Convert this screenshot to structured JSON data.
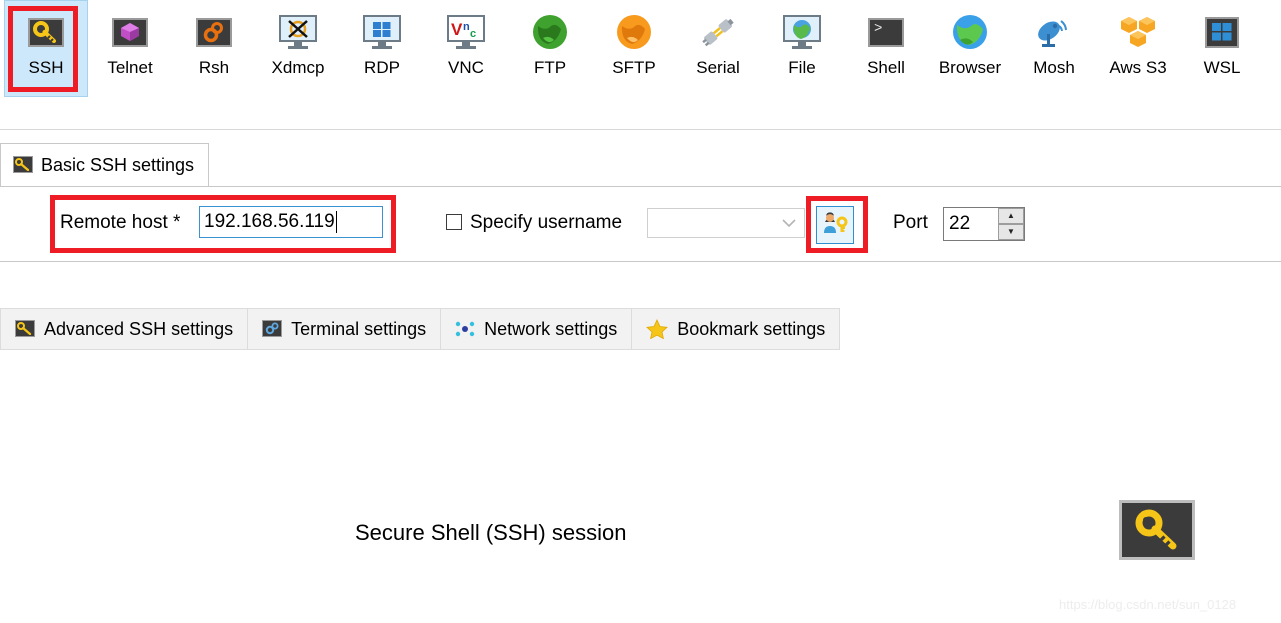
{
  "toolbar": {
    "items": [
      {
        "label": "SSH",
        "icon": "ssh-key-icon",
        "selected": true
      },
      {
        "label": "Telnet",
        "icon": "telnet-gem-icon",
        "selected": false
      },
      {
        "label": "Rsh",
        "icon": "rsh-gears-icon",
        "selected": false
      },
      {
        "label": "Xdmcp",
        "icon": "xdmcp-x-icon",
        "selected": false
      },
      {
        "label": "RDP",
        "icon": "rdp-windows-icon",
        "selected": false
      },
      {
        "label": "VNC",
        "icon": "vnc-monitor-icon",
        "selected": false
      },
      {
        "label": "FTP",
        "icon": "ftp-globe-icon",
        "selected": false
      },
      {
        "label": "SFTP",
        "icon": "sftp-globe-icon",
        "selected": false
      },
      {
        "label": "Serial",
        "icon": "serial-plug-icon",
        "selected": false
      },
      {
        "label": "File",
        "icon": "file-monitor-icon",
        "selected": false
      },
      {
        "label": "Shell",
        "icon": "shell-prompt-icon",
        "selected": false
      },
      {
        "label": "Browser",
        "icon": "browser-globe-icon",
        "selected": false
      },
      {
        "label": "Mosh",
        "icon": "mosh-satellite-icon",
        "selected": false
      },
      {
        "label": "Aws S3",
        "icon": "aws-s3-cubes-icon",
        "selected": false
      },
      {
        "label": "WSL",
        "icon": "wsl-windows-icon",
        "selected": false
      }
    ]
  },
  "top_tab": {
    "label": "Basic SSH settings",
    "icon": "key-icon"
  },
  "form": {
    "remote_host_label": "Remote host *",
    "remote_host_value": "192.168.56.119",
    "specify_username_label": "Specify username",
    "specify_username_checked": false,
    "username_value": "",
    "username_placeholder": "",
    "user_button_icon": "user-key-icon",
    "port_label": "Port",
    "port_value": "22",
    "spinner_up": "▲",
    "spinner_down": "▼",
    "combo_chevron": "chevron-down-icon"
  },
  "bottom_tabs": [
    {
      "label": "Advanced SSH settings",
      "icon": "key-icon"
    },
    {
      "label": "Terminal settings",
      "icon": "gears-icon"
    },
    {
      "label": "Network settings",
      "icon": "network-nodes-icon"
    },
    {
      "label": "Bookmark settings",
      "icon": "star-icon"
    }
  ],
  "body": {
    "session_title": "Secure Shell (SSH) session",
    "big_icon": "ssh-key-icon",
    "watermark": "https://blog.csdn.net/sun_0128"
  },
  "colors": {
    "selection_bg": "#cde8fa",
    "selection_border": "#a7d2ee",
    "annotation_red": "#ee1c25",
    "focus_blue": "#3a92d2",
    "key_yellow": "#f5c518",
    "panel_border": "#c8c8c8"
  }
}
